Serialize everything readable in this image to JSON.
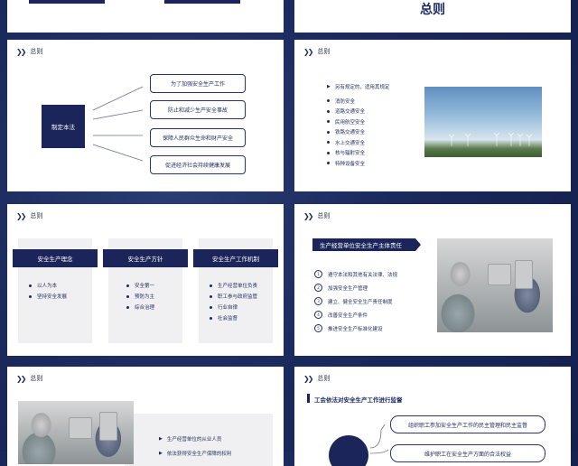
{
  "colors": {
    "navy": "#1b2559",
    "bg": "#1b2a5c",
    "card": "#f0f0f2"
  },
  "section_label": "总则",
  "slide_top_right": {
    "title": "总则"
  },
  "slide_law": {
    "center_label": "制定本法",
    "items": [
      "为了加强安全生产工作",
      "防止和减少生产安全事故",
      "保障人民群众生命和财产安全",
      "促进经济社会持续健康发展"
    ]
  },
  "slide_other": {
    "intro": "另有规定的，适用其规定",
    "items": [
      "消防安全",
      "道路交通安全",
      "民用航空安全",
      "铁路交通安全",
      "水上交通安全",
      "核与辐射安全",
      "特种设备安全"
    ]
  },
  "slide_cards": {
    "cards": [
      {
        "title": "安全生产理念",
        "items": [
          "以人为本",
          "坚持安全发展"
        ]
      },
      {
        "title": "安全生产方针",
        "items": [
          "安全第一",
          "预防为主",
          "综合治理"
        ]
      },
      {
        "title": "安全生产工作机制",
        "items": [
          "生产经营单位负责",
          "职工参与政府监管",
          "行业自律",
          "社会监督"
        ]
      }
    ]
  },
  "slide_resp": {
    "tag": "生产经营单位安全生产主体责任",
    "items": [
      "遵守本法和其他有关法律、法规",
      "加强安全生产管理",
      "建立、健全安全生产责任制度",
      "改善安全生产条件",
      "推进安全生产标准化建设"
    ]
  },
  "slide_workers": {
    "items": [
      "生产经营单位的从业人员",
      "依法获得安全生产保障的权利"
    ]
  },
  "slide_union": {
    "title": "工会依法对安全生产工作进行监督",
    "items": [
      "组织职工参加安全生产工作的民主管理和民主监督",
      "维护职工在安全生产方面的合法权益"
    ]
  }
}
